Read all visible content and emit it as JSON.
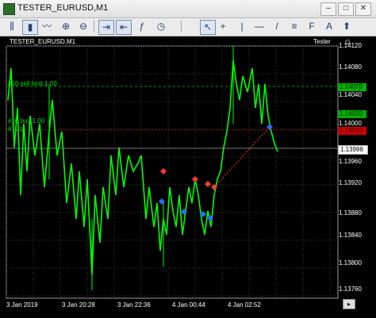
{
  "window": {
    "title": "TESTER_EURUSD,M1"
  },
  "chart": {
    "title": "TESTER_EURUSD,M1",
    "tester_label": "Tester",
    "orders": [
      {
        "text": "#10 sell limit 1.00"
      },
      {
        "text": "#10 buy 1.00"
      },
      {
        "text": "#11 tp"
      }
    ],
    "price_ticks": [
      "1.14120",
      "1.14080",
      "1.14040",
      "1.14000",
      "1.13960",
      "1.13920",
      "1.13880",
      "1.13840",
      "1.13800",
      "1.13760"
    ],
    "badges": [
      {
        "value": "1.14070",
        "kind": "green"
      },
      {
        "value": "1.14020",
        "kind": "green"
      },
      {
        "value": "1.14010",
        "kind": "red"
      },
      {
        "value": "1.13998",
        "kind": "white"
      }
    ],
    "time_ticks": [
      "3 Jan 2019",
      "3 Jan 20:28",
      "3 Jan 22:36",
      "4 Jan 00:44",
      "4 Jan 02:52"
    ],
    "colors": {
      "background": "#000000",
      "candles": "#00ff00",
      "grid": "#3a3a3a",
      "sell": "#ff3b30",
      "buy": "#2f6bff"
    }
  }
}
